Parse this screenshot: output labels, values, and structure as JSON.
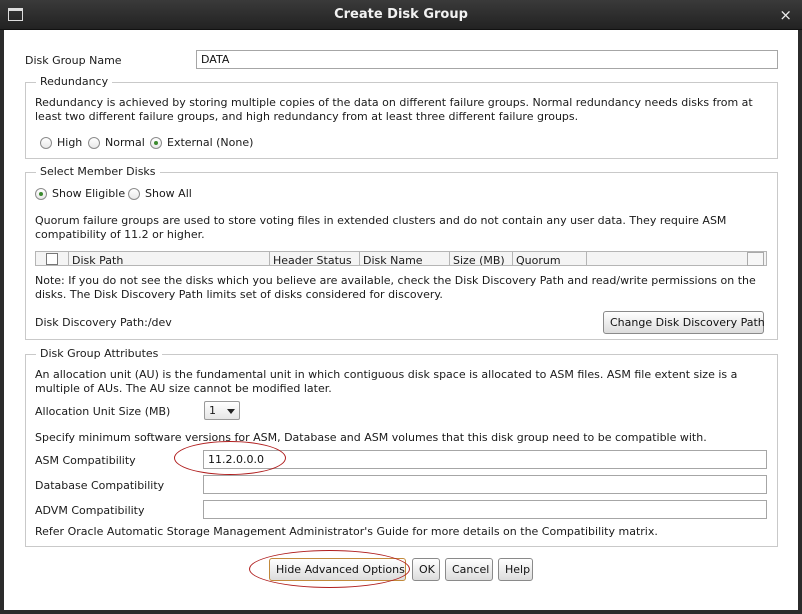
{
  "window": {
    "title": "Create Disk Group",
    "close_glyph": "×"
  },
  "disk_group_name": {
    "label": "Disk Group Name",
    "value": "DATA"
  },
  "redundancy": {
    "title": "Redundancy",
    "description": "Redundancy is achieved by storing multiple copies of the data on different failure groups. Normal redundancy needs disks from at least two different failure groups, and high redundancy from at least three different failure groups.",
    "options": [
      {
        "label": "High",
        "selected": false
      },
      {
        "label": "Normal",
        "selected": false
      },
      {
        "label": "External (None)",
        "selected": true
      }
    ]
  },
  "member_disks": {
    "title": "Select Member Disks",
    "filters": [
      {
        "label": "Show Eligible",
        "selected": true
      },
      {
        "label": "Show All",
        "selected": false
      }
    ],
    "quorum_note": "Quorum failure groups are used to store voting files in extended clusters and do not contain any user data. They require ASM compatibility of 11.2 or higher.",
    "columns": [
      "Disk Path",
      "Header Status",
      "Disk Name",
      "Size (MB)",
      "Quorum"
    ],
    "discovery_note": "Note: If you do not see the disks which you believe are available, check the Disk Discovery Path and read/write permissions on the disks. The Disk Discovery Path limits set of disks considered for discovery.",
    "discovery_path": "Disk Discovery Path:/dev",
    "change_path_label": "Change Disk Discovery Path"
  },
  "attributes": {
    "title": "Disk Group Attributes",
    "au_description": "An allocation unit (AU) is the fundamental unit in which contiguous disk space is allocated to ASM files. ASM file extent size is a multiple of AUs. The AU size cannot be modified later.",
    "au_size_label": "Allocation Unit Size (MB)",
    "au_size_value": "1",
    "compat_description": "Specify minimum software versions for ASM, Database and ASM volumes that this disk group need to be compatible with.",
    "asm_label": "ASM Compatibility",
    "asm_value": "11.2.0.0.0",
    "db_label": "Database Compatibility",
    "db_value": "",
    "advm_label": "ADVM Compatibility",
    "advm_value": "",
    "refer_note": "Refer Oracle Automatic Storage Management Administrator's Guide for more details on the Compatibility matrix."
  },
  "buttons": {
    "hide_advanced": "Hide Advanced Options",
    "ok": "OK",
    "cancel": "Cancel",
    "help": "Help"
  },
  "colors": {
    "annotation": "#b01e1e",
    "selected_radio": "#3c8a2e",
    "title_bar": "#2b2b2b"
  }
}
